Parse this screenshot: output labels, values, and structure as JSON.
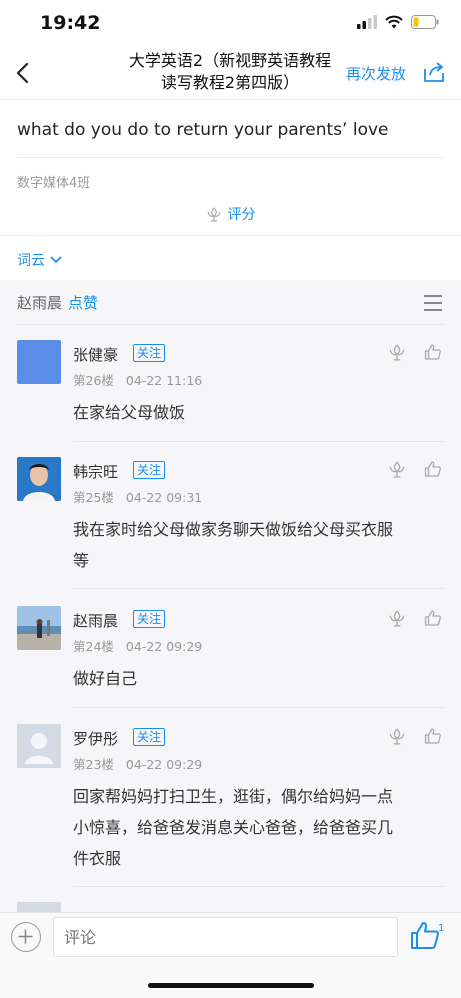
{
  "status_bar": {
    "time": "19:42"
  },
  "nav": {
    "title_line1": "大学英语2（新视野英语教程",
    "title_line2": "读写教程2第四版）",
    "resend_label": "再次发放"
  },
  "topic": {
    "question": "what do you do to return your parents’ love",
    "class_name": "数字媒体4班",
    "rate_label": "评分"
  },
  "wordcloud_label": "词云",
  "likes_bar": {
    "user": "赵雨晨",
    "liked_label": "点赞"
  },
  "follow_label": "关注",
  "comments": [
    {
      "name": "张健豪",
      "floor": "第26楼",
      "time": "04-22 11:16",
      "text": "在家给父母做饭"
    },
    {
      "name": "韩宗旺",
      "floor": "第25楼",
      "time": "04-22 09:31",
      "text_line1": "我在家时给父母做家务聊天做饭给父母买衣服",
      "text_line2": "等"
    },
    {
      "name": "赵雨晨",
      "floor": "第24楼",
      "time": "04-22 09:29",
      "text": "做好自己"
    },
    {
      "name": "罗伊彤",
      "floor": "第23楼",
      "time": "04-22 09:29",
      "text_line1": "回家帮妈妈打扫卫生，逛街，偶尔给妈妈一点",
      "text_line2": "小惊喜，给爸爸发消息关心爸爸，给爸爸买几",
      "text_line3": "件衣服"
    }
  ],
  "bottom_bar": {
    "comment_placeholder": "评论",
    "like_count": "1"
  },
  "colors": {
    "accent": "#1a8ff0",
    "background_gray": "#f6f6f8"
  }
}
